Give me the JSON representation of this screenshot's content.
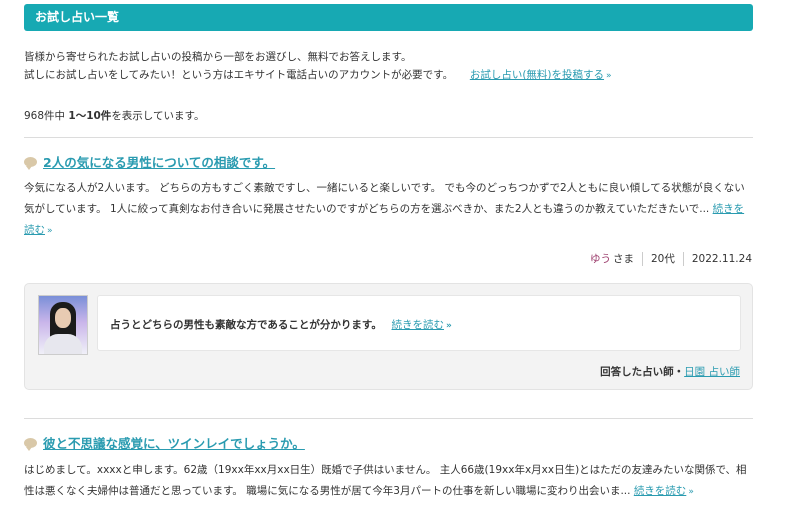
{
  "header": {
    "title": "お試し占い一覧"
  },
  "intro": {
    "line1": "皆様から寄せられたお試し占いの投稿から一部をお選びし、無料でお答えします。",
    "line2": "試しにお試し占いをしてみたい！という方はエキサイト電話占いのアカウントが必要です。",
    "post_link": "お試し占い(無料)を投稿する"
  },
  "count": {
    "total": "968件中",
    "range": "1〜10件",
    "suffix": "を表示しています。"
  },
  "posts": [
    {
      "title": "2人の気になる男性についての相談です。",
      "body": "今気になる人が2人います。 どちらの方もすごく素敵ですし、一緒にいると楽しいです。 でも今のどっちつかずで2人ともに良い傾してる状態が良くない気がしています。 1人に絞って真剣なお付き合いに発展させたいのですがどちらの方を選ぶべきか、また2人とも違うのか教えていただきたいで...",
      "read_more": "続きを読む",
      "author": "ゆう",
      "honorific": "さま",
      "age": "20代",
      "date": "2022.11.24",
      "answer": {
        "text": "占うとどちらの男性も素敵な方であることが分かります。",
        "read_more": "続きを読む",
        "answerer_label": "回答した占い師・",
        "answerer_name": "日園 占い師"
      }
    },
    {
      "title": "彼と不思議な感覚に、ツインレイでしょうか。",
      "body": "はじめまして。xxxxと申します。62歳（19xx年xx月xx日生）既婚で子供はいません。 主人66歳(19xx年x月xx日生)とはただの友達みたいな関係で、相性は悪くなく夫婦仲は普通だと思っています。 職場に気になる男性が居て今年3月パートの仕事を新しい職場に変わり出会いま...",
      "read_more": "続きを読む"
    }
  ]
}
